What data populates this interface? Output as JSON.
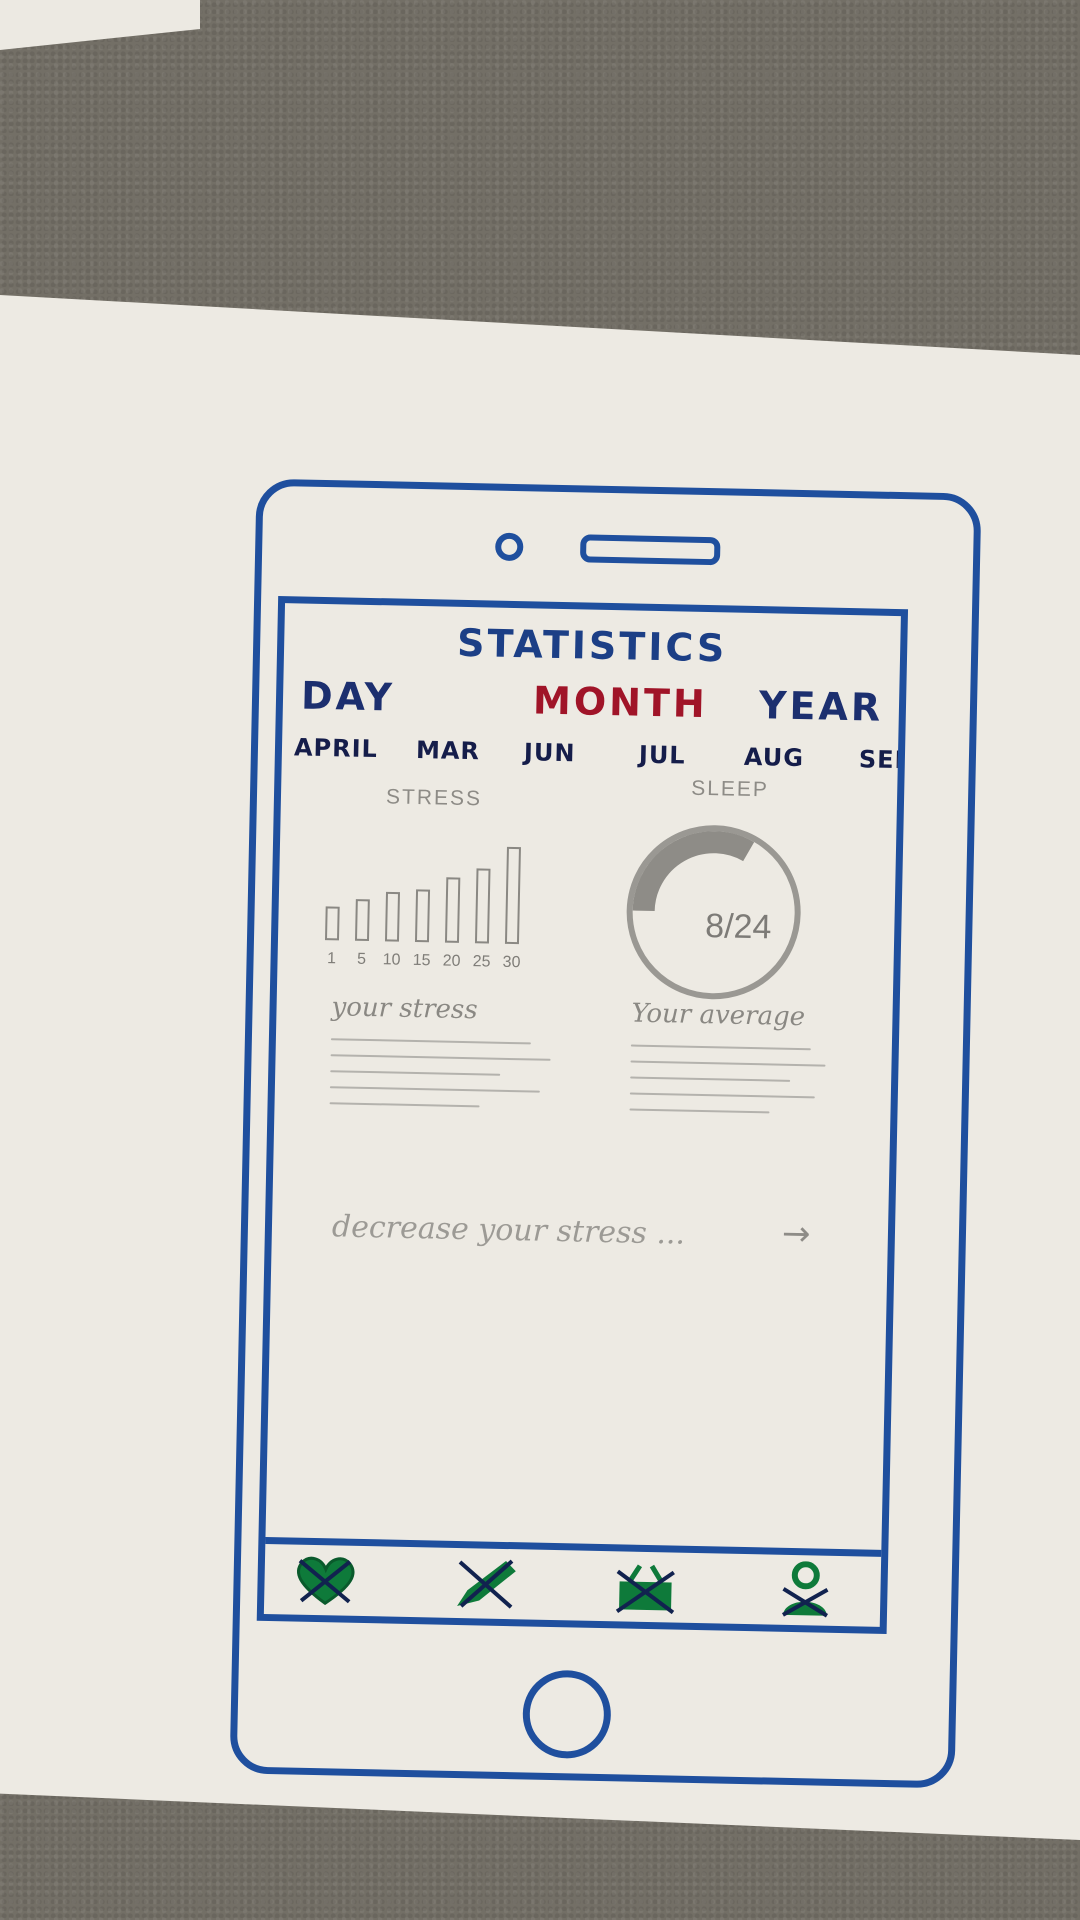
{
  "screen": {
    "title": "STATISTICS",
    "periods": [
      {
        "label": "DAY",
        "active": false
      },
      {
        "label": "MONTH",
        "active": true
      },
      {
        "label": "YEAR",
        "active": false
      }
    ],
    "months": [
      "APRIL",
      "MAR",
      "JUN",
      "JUL",
      "AUG",
      "SEP"
    ],
    "stress": {
      "label": "STRESS",
      "caption": "your stress",
      "chart_data": {
        "type": "bar",
        "categories": [
          "1",
          "5",
          "10",
          "15",
          "20",
          "25",
          "30"
        ],
        "values": [
          2,
          2.5,
          3,
          3.2,
          4,
          4.6,
          6
        ]
      }
    },
    "sleep": {
      "label": "SLEEP",
      "value": "8/24",
      "fraction": 0.33,
      "caption": "Your average"
    },
    "cta": {
      "label": "decrease your stress ...",
      "arrow": "→"
    },
    "tabs": [
      {
        "icon": "heart-icon"
      },
      {
        "icon": "pencil-icon"
      },
      {
        "icon": "basket-icon"
      },
      {
        "icon": "person-icon"
      }
    ]
  },
  "colors": {
    "ink_blue": "#1f4f9e",
    "ink_navy": "#1c2f6f",
    "ink_red": "#a01428",
    "ink_green": "#0e7a3a",
    "pencil": "#8d8b86"
  }
}
